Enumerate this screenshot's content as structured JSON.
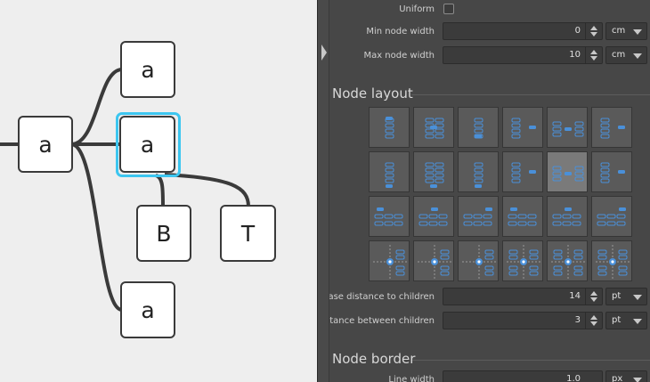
{
  "mindmap": {
    "root": {
      "text": "a"
    },
    "children": [
      {
        "text": "a"
      },
      {
        "text": "a",
        "selected": true
      },
      {
        "text": "a"
      }
    ],
    "grandchildren": [
      {
        "text": "B"
      },
      {
        "text": "T"
      }
    ],
    "accent": "#3cc6f0"
  },
  "panel": {
    "uniform_label": "Uniform",
    "min_width": {
      "label": "Min node width",
      "value": "0",
      "unit": "cm"
    },
    "max_width": {
      "label": "Max node width",
      "value": "10",
      "unit": "cm"
    },
    "node_layout_title": "Node layout",
    "layout_presets": [
      "right-top",
      "right-center",
      "right-bottom",
      "left-top",
      "center-both",
      "left-center",
      "right-top-b",
      "right-center-b",
      "right-bottom-b",
      "left-b",
      "center-b-selected",
      "left-b2",
      "top-left",
      "top-center",
      "top-right",
      "top-left-2",
      "top-center-2",
      "top-right-2",
      "cross-left",
      "cross-center",
      "cross-right",
      "radial-1",
      "radial-2",
      "radial-3"
    ],
    "selected_layout_index": 10,
    "base_distance": {
      "label": "Base distance to children",
      "value": "14",
      "unit": "pt"
    },
    "distance_between": {
      "label": "Distance between children",
      "value": "3",
      "unit": "pt"
    },
    "node_border_title": "Node border",
    "line_width": {
      "label": "Line width",
      "value": "1.0",
      "unit": "px"
    }
  }
}
